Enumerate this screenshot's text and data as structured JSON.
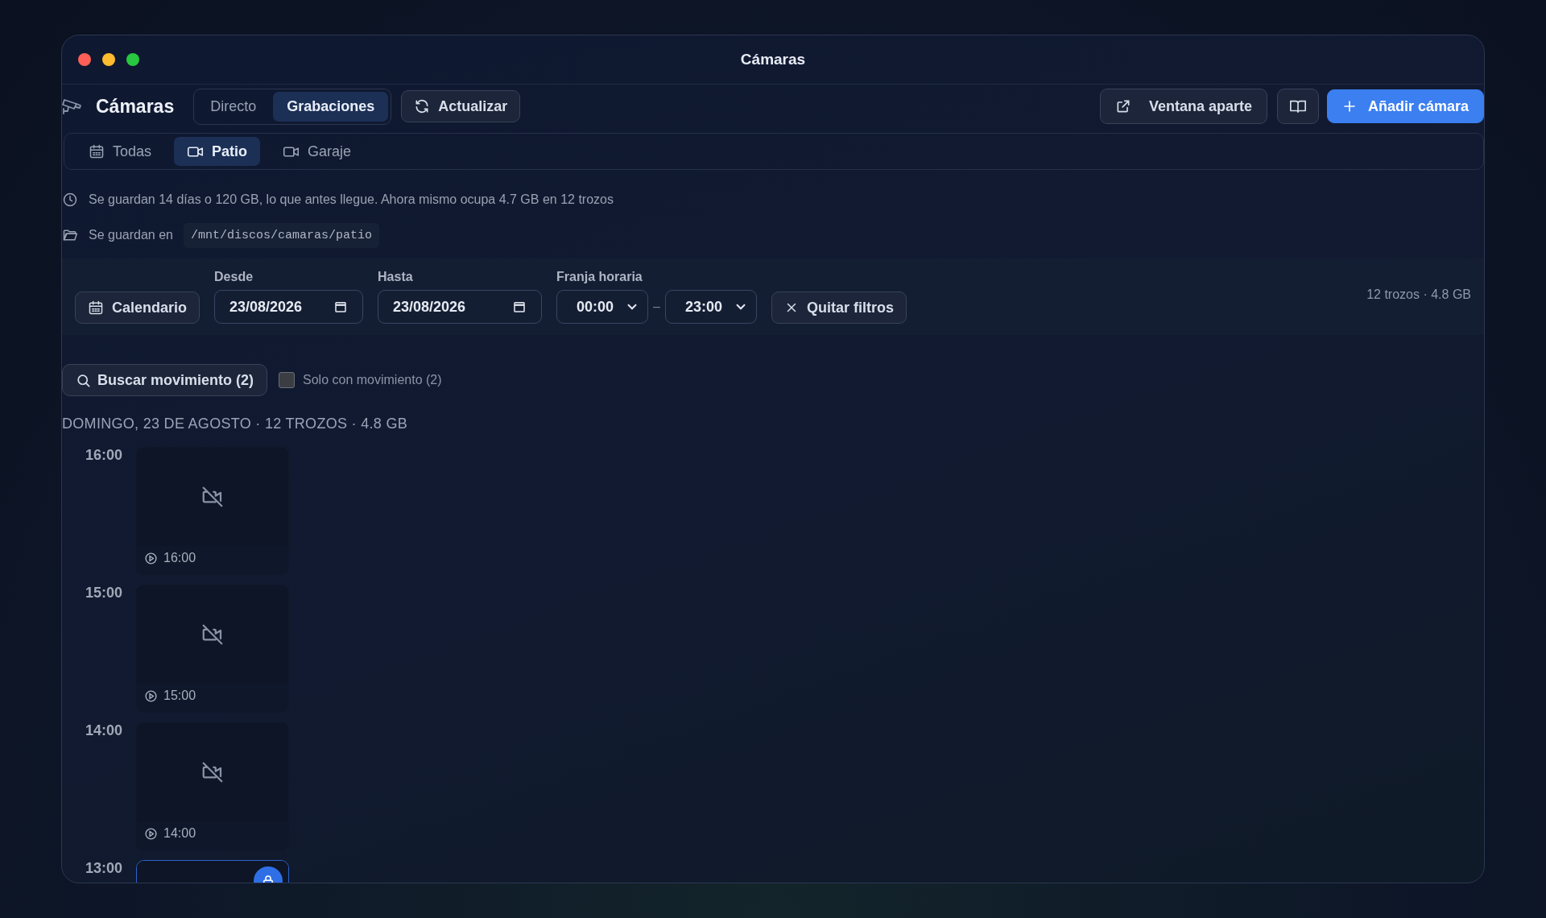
{
  "window": {
    "title": "Cámaras"
  },
  "toolbar": {
    "app_title": "Cámaras",
    "modes": [
      {
        "label": "Directo",
        "selected": false
      },
      {
        "label": "Grabaciones",
        "selected": true
      }
    ],
    "refresh_button": "Actualizar",
    "popout_button": "Ventana aparte",
    "add_button": "Añadir cámara"
  },
  "camera_tabs": [
    {
      "label": "Todas",
      "kind": "all",
      "selected": false
    },
    {
      "label": "Patio",
      "kind": "camera",
      "selected": true
    },
    {
      "label": "Garaje",
      "kind": "camera",
      "selected": false
    }
  ],
  "info": {
    "retention": "Se guardan 14 días o 120 GB, lo que antes llegue. Ahora mismo ocupa 4.7 GB en 12 trozos",
    "storage_label": "Se guardan en",
    "storage_path": "/mnt/discos/camaras/patio"
  },
  "filters": {
    "calendar_button": "Calendario",
    "from": {
      "label": "Desde",
      "value": "23/08/2026"
    },
    "to": {
      "label": "Hasta",
      "value": "23/08/2026"
    },
    "time_range": {
      "label": "Franja horaria",
      "start": "00:00",
      "separator": "–",
      "end": "23:00"
    },
    "clear_button": "Quitar filtros",
    "summary": "12 trozos · 4.8 GB"
  },
  "motion": {
    "search_button": "Buscar movimiento (2)",
    "only_motion": {
      "label": "Solo con movimiento (2)",
      "checked": false
    }
  },
  "day_heading": "DOMINGO, 23 DE AGOSTO · 12 TROZOS · 4.8 GB",
  "timeline": [
    {
      "hour": "16:00",
      "clips": [
        {
          "time": "16:00",
          "selected": false,
          "locked": false
        }
      ]
    },
    {
      "hour": "15:00",
      "clips": [
        {
          "time": "15:00",
          "selected": false,
          "locked": false
        }
      ]
    },
    {
      "hour": "14:00",
      "clips": [
        {
          "time": "14:00",
          "selected": false,
          "locked": false
        }
      ]
    },
    {
      "hour": "13:00",
      "clips": [
        {
          "selected": true,
          "locked": true
        }
      ]
    }
  ]
}
